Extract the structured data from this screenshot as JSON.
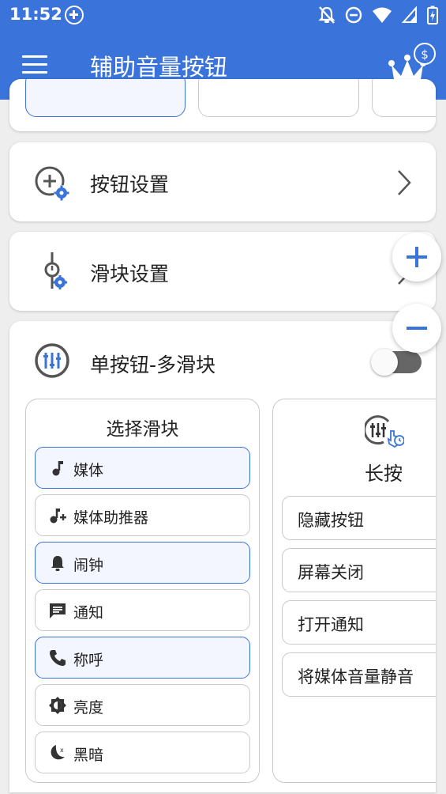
{
  "status_bar": {
    "time": "11:52",
    "icons": [
      "add-circle-icon",
      "notifications-off-icon",
      "do-not-disturb-icon",
      "wifi-icon",
      "signal-icon",
      "battery-charging-icon"
    ]
  },
  "app_bar": {
    "title": "辅助音量按钮",
    "menu_icon": "hamburger-menu-icon",
    "premium_icon": "crown-dollar-icon"
  },
  "settings_rows": [
    {
      "label": "按钮设置",
      "icon": "add-circle-gear-icon"
    },
    {
      "label": "滑块设置",
      "icon": "slider-gear-icon"
    }
  ],
  "floating": {
    "plus_icon": "zoom-in-icon",
    "minus_icon": "zoom-out-icon"
  },
  "mode_card": {
    "label": "单按钮-多滑块",
    "icon": "equalizer-icon",
    "toggle_on": false,
    "select_slider": {
      "title": "选择滑块",
      "items": [
        {
          "label": "媒体",
          "icon": "music-note-icon",
          "selected": true
        },
        {
          "label": "媒体助推器",
          "icon": "music-plus-icon",
          "selected": false
        },
        {
          "label": "闹钟",
          "icon": "bell-icon",
          "selected": true
        },
        {
          "label": "通知",
          "icon": "message-icon",
          "selected": false
        },
        {
          "label": "称呼",
          "icon": "phone-icon",
          "selected": true
        },
        {
          "label": "亮度",
          "icon": "brightness-icon",
          "selected": false
        },
        {
          "label": "黑暗",
          "icon": "dark-mode-icon",
          "selected": false
        }
      ]
    },
    "long_press": {
      "title": "长按",
      "icon": "equalizer-touch-icon",
      "actions": [
        "隐藏按钮",
        "屏幕关闭",
        "打开通知",
        "将媒体音量静音"
      ]
    }
  },
  "colors": {
    "primary": "#3a73d9",
    "selected_bg": "#f3f6ff",
    "border": "#c9c9c9",
    "background": "#eeeeee"
  }
}
